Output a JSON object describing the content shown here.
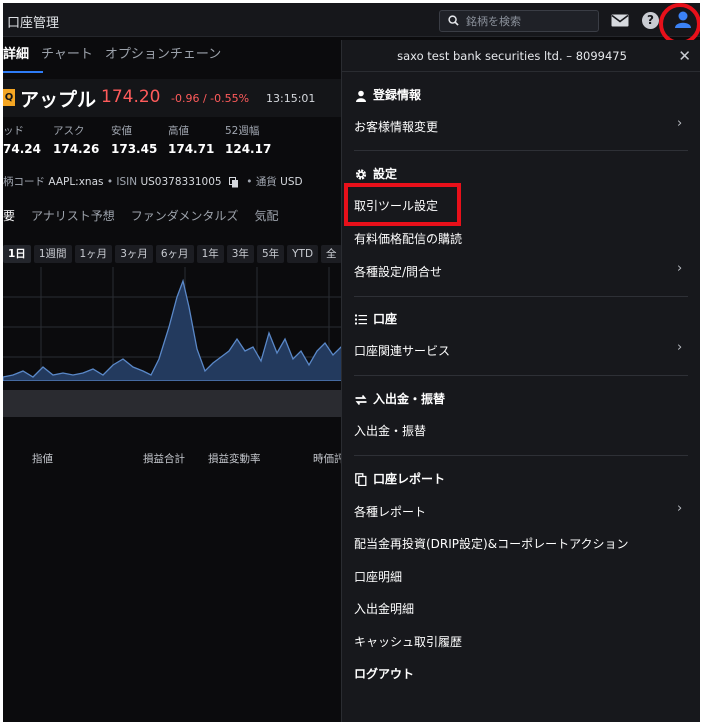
{
  "app": {
    "title": "口座管理"
  },
  "search": {
    "placeholder": "銘柄を検索"
  },
  "icons": {
    "mail": "mail-icon",
    "help": "help-icon",
    "user": "user-icon",
    "search": "search-icon",
    "close": "close-icon"
  },
  "tabs": [
    {
      "label": "詳細",
      "active": true
    },
    {
      "label": "チャート",
      "active": false
    },
    {
      "label": "オプションチェーン",
      "active": false
    }
  ],
  "quote": {
    "logo": "Q",
    "name": "アップル",
    "price": "174.20",
    "change": "-0.96 / -0.55%",
    "time": "13:15:01",
    "change_color": "#ff5b5b"
  },
  "stats": [
    {
      "label": "ッド",
      "value": "74.24"
    },
    {
      "label": "アスク",
      "value": "174.26"
    },
    {
      "label": "安値",
      "value": "173.45"
    },
    {
      "label": "高値",
      "value": "174.71"
    },
    {
      "label": "52週幅",
      "value": "124.17"
    }
  ],
  "codes": {
    "code_label": "柄コード",
    "code_value": "AAPL:xnas",
    "isin_label": "ISIN",
    "isin_value": "US0378331005",
    "currency_label": "通貨",
    "currency_value": "USD"
  },
  "subtabs": [
    {
      "label": "要",
      "active": true
    },
    {
      "label": "アナリスト予想",
      "active": false
    },
    {
      "label": "ファンダメンタルズ",
      "active": false
    },
    {
      "label": "気配",
      "active": false
    }
  ],
  "ranges": [
    {
      "label": "1日",
      "active": true
    },
    {
      "label": "1週間",
      "active": false
    },
    {
      "label": "1ヶ月",
      "active": false
    },
    {
      "label": "3ヶ月",
      "active": false
    },
    {
      "label": "6ヶ月",
      "active": false
    },
    {
      "label": "1年",
      "active": false
    },
    {
      "label": "3年",
      "active": false
    },
    {
      "label": "5年",
      "active": false
    },
    {
      "label": "YTD",
      "active": false
    },
    {
      "label": "全",
      "active": false
    }
  ],
  "columns": [
    "指値",
    "損益合計",
    "損益変動率",
    "時価評"
  ],
  "menu": {
    "account": "saxo test bank securities ltd. – 8099475",
    "sections": [
      {
        "title": "登録情報",
        "icon": "person-icon",
        "items": [
          {
            "label": "お客様情報変更",
            "chevron": true
          }
        ]
      },
      {
        "title": "設定",
        "icon": "gear-icon",
        "items": [
          {
            "label": "取引ツール設定",
            "chevron": false,
            "highlighted": true
          },
          {
            "label": "有料価格配信の購読",
            "chevron": false
          },
          {
            "label": "各種設定/問合せ",
            "chevron": true
          }
        ]
      },
      {
        "title": "口座",
        "icon": "list-icon",
        "items": [
          {
            "label": "口座関連サービス",
            "chevron": true
          }
        ]
      },
      {
        "title": "入出金・振替",
        "icon": "transfer-icon",
        "items": [
          {
            "label": "入出金・振替",
            "chevron": false
          }
        ]
      },
      {
        "title": "口座レポート",
        "icon": "report-icon",
        "items": [
          {
            "label": "各種レポート",
            "chevron": true
          },
          {
            "label": "配当金再投資(DRIP設定)&コーポレートアクション",
            "chevron": false
          },
          {
            "label": "口座明細",
            "chevron": false
          },
          {
            "label": "入出金明細",
            "chevron": false
          },
          {
            "label": "キャッシュ取引履歴",
            "chevron": false
          }
        ]
      }
    ],
    "logout": "ログアウト"
  },
  "colors": {
    "accent": "#2e7cf6",
    "highlight": "#e8101a",
    "negative": "#ff5b5b"
  }
}
